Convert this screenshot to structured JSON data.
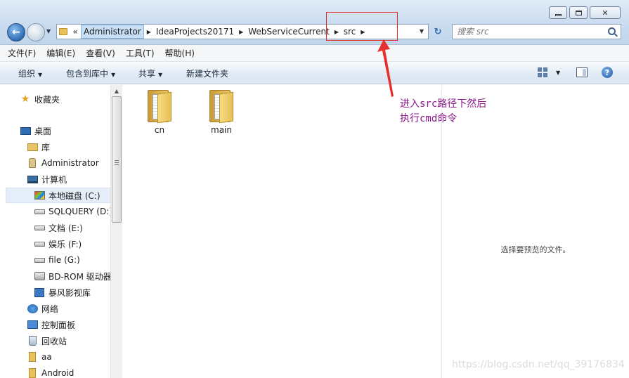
{
  "window": {
    "controls": {
      "minimize_icon": "minimize-icon",
      "maximize_icon": "maximize-icon",
      "close_glyph": "✕"
    }
  },
  "navigation": {
    "back_glyph": "←",
    "forward_glyph": "→",
    "recent_glyph": "▼"
  },
  "address_bar": {
    "chevrons": "«",
    "breadcrumbs": [
      "Administrator",
      "IdeaProjects20171",
      "WebServiceCurrent",
      "src"
    ],
    "dropdown_glyph": "▼",
    "refresh_glyph": "↻"
  },
  "search": {
    "placeholder": "搜索 src"
  },
  "menubar": {
    "items": [
      "文件(F)",
      "编辑(E)",
      "查看(V)",
      "工具(T)",
      "帮助(H)"
    ]
  },
  "toolbar": {
    "organize": "组织",
    "include_in_library": "包含到库中",
    "share": "共享",
    "new_folder": "新建文件夹",
    "help_glyph": "?"
  },
  "sidebar": {
    "items": [
      {
        "label": "收藏夹",
        "icon": "star-icon"
      },
      {
        "label": "桌面",
        "icon": "desktop-icon"
      },
      {
        "label": "库",
        "icon": "library-icon"
      },
      {
        "label": "Administrator",
        "icon": "user-folder-icon"
      },
      {
        "label": "计算机",
        "icon": "computer-icon"
      },
      {
        "label": "本地磁盘 (C:)",
        "icon": "system-drive-icon",
        "selected": true
      },
      {
        "label": "SQLQUERY (D:)",
        "icon": "drive-icon"
      },
      {
        "label": "文档 (E:)",
        "icon": "drive-icon"
      },
      {
        "label": "娱乐 (F:)",
        "icon": "drive-icon"
      },
      {
        "label": "file (G:)",
        "icon": "drive-icon"
      },
      {
        "label": "BD-ROM 驱动器",
        "icon": "optical-drive-icon"
      },
      {
        "label": "暴风影视库",
        "icon": "video-library-icon"
      },
      {
        "label": "网络",
        "icon": "network-icon"
      },
      {
        "label": "控制面板",
        "icon": "control-panel-icon"
      },
      {
        "label": "回收站",
        "icon": "recycle-bin-icon"
      },
      {
        "label": "aa",
        "icon": "folder-icon"
      },
      {
        "label": "Android",
        "icon": "folder-icon"
      }
    ]
  },
  "files": [
    {
      "name": "cn",
      "icon": "folder-icon"
    },
    {
      "name": "main",
      "icon": "folder-icon"
    }
  ],
  "preview": {
    "empty_text": "选择要预览的文件。"
  },
  "annotation": {
    "line1": "进入src路径下然后",
    "line2": "执行cmd命令",
    "color": "#8b1a8e",
    "box_color": "#e53030"
  },
  "watermark": "https://blog.csdn.net/qq_39176834"
}
